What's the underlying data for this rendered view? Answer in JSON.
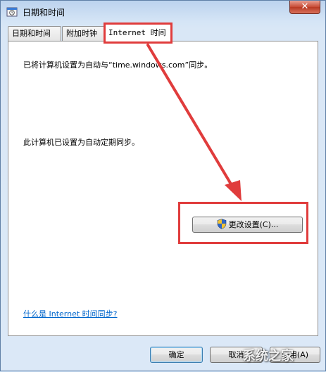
{
  "window": {
    "title": "日期和时间",
    "close_label": "✕"
  },
  "tabs": [
    {
      "label": "日期和时间"
    },
    {
      "label": "附加时钟"
    },
    {
      "label": "Internet 时间"
    }
  ],
  "content": {
    "sync_server_text": "已将计算机设置为自动与“time.windows.com”同步。",
    "auto_sync_text": "此计算机已设置为自动定期同步。",
    "change_settings_label": "更改设置(C)...",
    "help_link": "什么是 Internet 时间同步?"
  },
  "footer": {
    "ok_label": "确定",
    "cancel_label": "取消",
    "apply_label": "应用(A)"
  },
  "annotation": {
    "highlight_color": "#e03c3c"
  },
  "watermark": {
    "text": "系统之家"
  }
}
